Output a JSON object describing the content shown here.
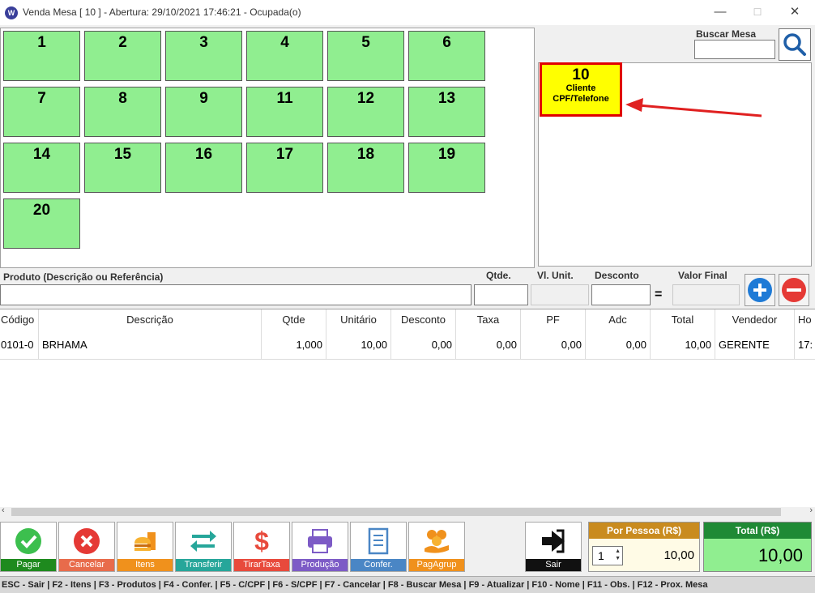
{
  "window": {
    "title": "Venda Mesa [ 10 ] - Abertura: 29/10/2021 17:46:21 - Ocupada(o)",
    "minimize": "—",
    "maximize": "☐",
    "close": "✕"
  },
  "tables": [
    "1",
    "2",
    "3",
    "4",
    "5",
    "6",
    "7",
    "8",
    "9",
    "10",
    "11",
    "12",
    "13",
    "14",
    "15",
    "16",
    "17",
    "18",
    "19",
    "20"
  ],
  "search": {
    "label": "Buscar Mesa",
    "value": ""
  },
  "selected_table": {
    "number": "10",
    "line1": "Cliente",
    "line2": "CPF/Telefone"
  },
  "entry": {
    "produto_label": "Produto (Descrição ou Referência)",
    "qtde_label": "Qtde.",
    "vl_unit_label": "Vl. Unit.",
    "desconto_label": "Desconto",
    "eq": "=",
    "valor_final_label": "Valor Final"
  },
  "grid": {
    "headers": [
      "Código",
      "Descrição",
      "Qtde",
      "Unitário",
      "Desconto",
      "Taxa",
      "PF",
      "Adc",
      "Total",
      "Vendedor",
      "Ho"
    ],
    "rows": [
      [
        "0101-0",
        "BRHAMA",
        "1,000",
        "10,00",
        "0,00",
        "0,00",
        "0,00",
        "0,00",
        "10,00",
        "GERENTE",
        "17:"
      ]
    ]
  },
  "toolbar": {
    "pagar": "Pagar",
    "cancelar": "Cancelar",
    "itens": "Itens",
    "transferir": "Transferir",
    "tirartaxa": "TirarTaxa",
    "producao": "Produção",
    "confer": "Confer.",
    "pagagrup": "PagAgrup",
    "sair": "Sair"
  },
  "por_pessoa": {
    "title": "Por Pessoa (R$)",
    "people": "1",
    "value": "10,00"
  },
  "total": {
    "title": "Total (R$)",
    "value": "10,00"
  },
  "shortcuts": "ESC - Sair | F2 - Itens | F3 - Produtos | F4 - Confer. | F5 - C/CPF | F6 - S/CPF | F7 - Cancelar | F8 - Buscar Mesa | F9 - Atualizar | F10 - Nome | F11 - Obs. | F12 - Prox. Mesa",
  "colors": {
    "tile": "#90ee90",
    "selected_tile": "#ffff00",
    "selected_border": "#e00000",
    "pagar": "#1e8a1e",
    "cancelar": "#e86b4b",
    "itens": "#f0911c",
    "transferir": "#26a69a",
    "tirartaxa": "#e84a3c",
    "producao": "#7d5bc6",
    "confer": "#4a86c5",
    "pagagrup": "#f0911c"
  }
}
